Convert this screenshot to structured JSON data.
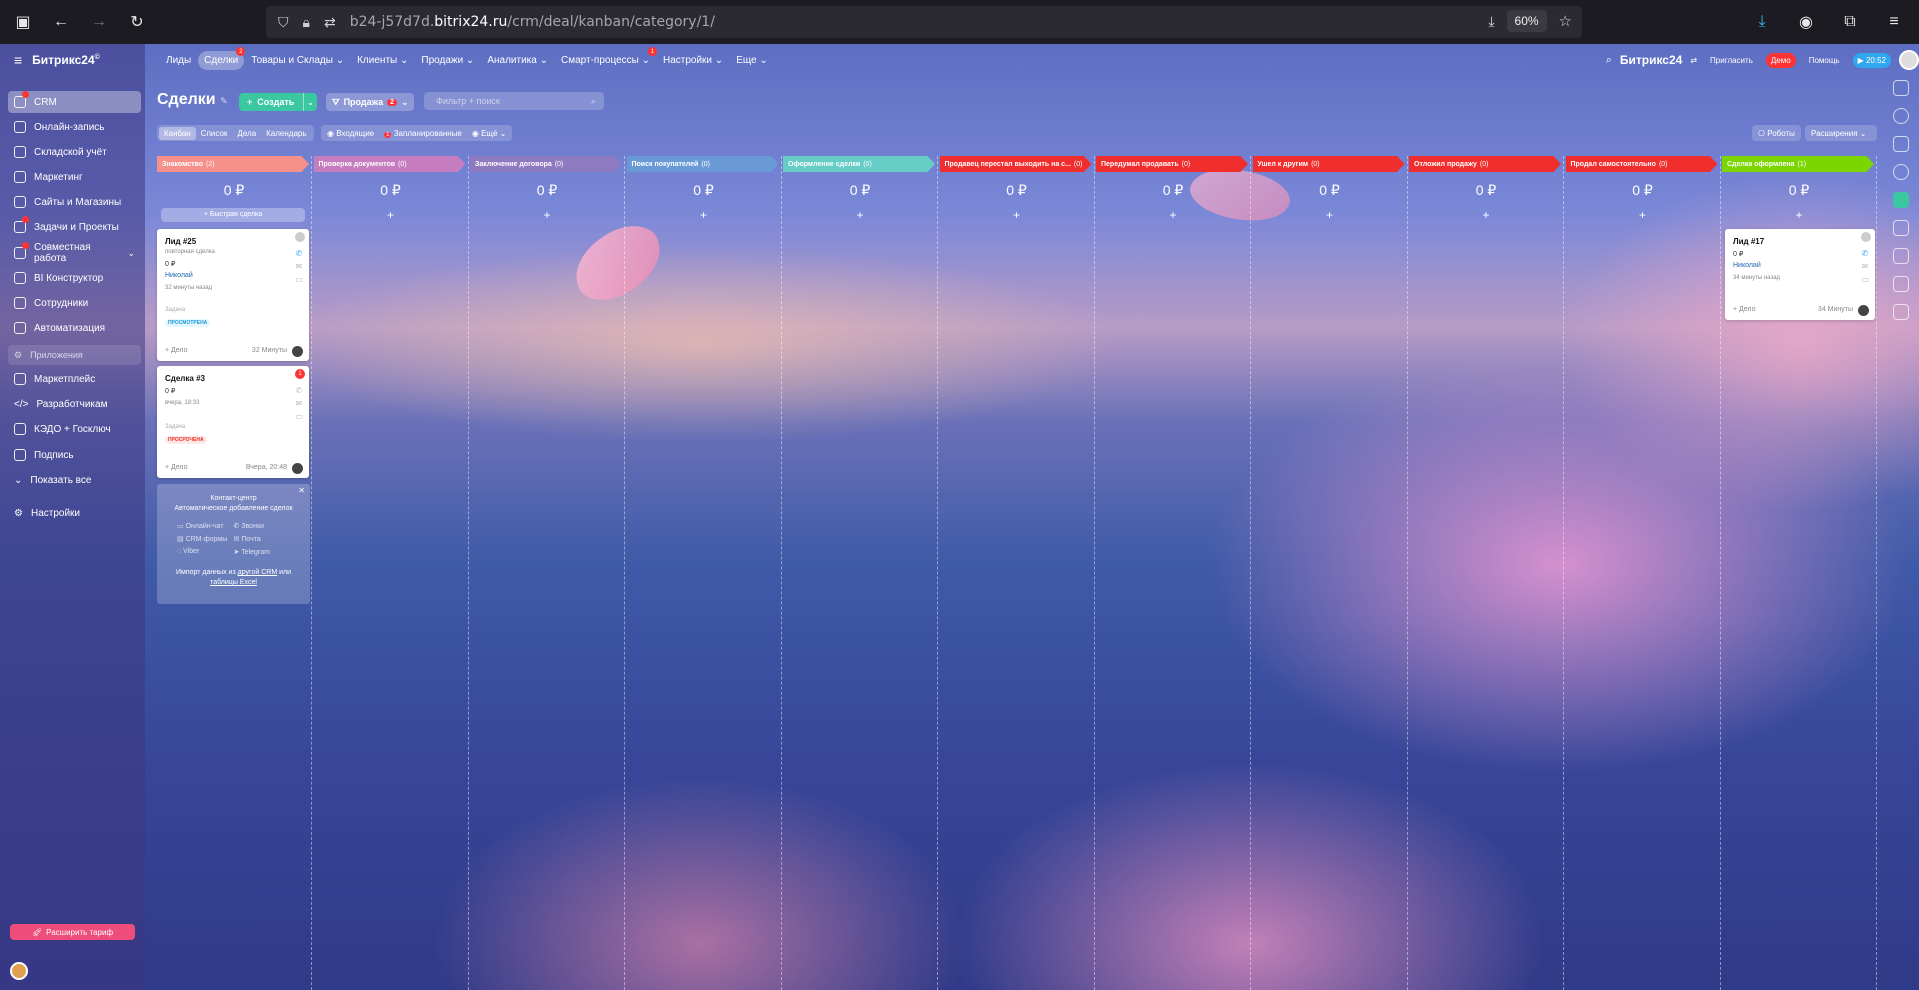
{
  "browser": {
    "url_prefix": "b24-j57d7d.",
    "url_domain": "bitrix24.ru",
    "url_path": "/crm/deal/kanban/category/1/",
    "zoom": "60%"
  },
  "sidebar": {
    "logo": "Битрикс24",
    "logo_sup": "©",
    "items": [
      {
        "label": "CRM",
        "badge": true
      },
      {
        "label": "Онлайн-запись"
      },
      {
        "label": "Складской учёт"
      },
      {
        "label": "Маркетинг"
      },
      {
        "label": "Сайты и Магазины"
      },
      {
        "label": "Задачи и Проекты",
        "badge": true
      },
      {
        "label": "Совместная работа",
        "badge": true
      },
      {
        "label": "BI Конструктор"
      },
      {
        "label": "Сотрудники"
      },
      {
        "label": "Автоматизация"
      }
    ],
    "section_label": "Приложения",
    "items2": [
      {
        "label": "Маркетплейс"
      },
      {
        "label": "Разработчикам"
      },
      {
        "label": "КЭДО + Госключ"
      },
      {
        "label": "Подпись"
      },
      {
        "label": "Показать все"
      },
      {
        "label": "Настройки"
      }
    ],
    "upgrade": "Расширить тариф"
  },
  "topnav": {
    "items": [
      "Лиды",
      "Сделки",
      "Товары и Склады",
      "Клиенты",
      "Продажи",
      "Аналитика",
      "Смарт-процессы",
      "Настройки",
      "Еще"
    ],
    "deals_badge": "2",
    "smart_badge": "1",
    "right_logo": "Битрикс24",
    "invite": "Пригласить",
    "demo": "Демо",
    "help": "Помощь",
    "time": "20:52"
  },
  "page": {
    "title": "Сделки",
    "create": "Создать",
    "category": "Продажа",
    "category_count": "2",
    "filter_placeholder": "Фильтр + поиск",
    "view_tabs": [
      "Канбан",
      "Список",
      "Дела",
      "Календарь"
    ],
    "presets": [
      "Входящие",
      "Запланированные",
      "Ещё"
    ],
    "presets_badge": "1",
    "robots": "Роботы",
    "extensions": "Расширения"
  },
  "columns": [
    {
      "name": "Знакомство",
      "count": "(2)",
      "color": "#f5918a",
      "sum": "0 ₽"
    },
    {
      "name": "Проверка документов",
      "count": "(0)",
      "color": "#c57dc0",
      "sum": "0 ₽"
    },
    {
      "name": "Заключение договора",
      "count": "(0)",
      "color": "#8d7ac0",
      "sum": "0 ₽"
    },
    {
      "name": "Поиск покупателей",
      "count": "(0)",
      "color": "#6a9ad6",
      "sum": "0 ₽"
    },
    {
      "name": "Оформление сделки",
      "count": "(0)",
      "color": "#66ccc6",
      "sum": "0 ₽"
    },
    {
      "name": "Продавец перестал выходить на с...",
      "count": "(0)",
      "color": "#f12e2e",
      "sum": "0 ₽"
    },
    {
      "name": "Передумал продавать",
      "count": "(0)",
      "color": "#f12e2e",
      "sum": "0 ₽"
    },
    {
      "name": "Ушел к другим",
      "count": "(0)",
      "color": "#f12e2e",
      "sum": "0 ₽"
    },
    {
      "name": "Отложил продажу",
      "count": "(0)",
      "color": "#f12e2e",
      "sum": "0 ₽"
    },
    {
      "name": "Продал самостоятельно",
      "count": "(0)",
      "color": "#f12e2e",
      "sum": "0 ₽"
    },
    {
      "name": "Сделка оформлена",
      "count": "(1)",
      "color": "#7bd500",
      "sum": "0 ₽"
    }
  ],
  "quick_deal": "Быстрая сделка",
  "cards": {
    "c1": {
      "title": "Лид #25",
      "sub": "повторная сделка",
      "sum": "0 ₽",
      "contact": "Николай",
      "ago": "32 минуты назад",
      "label": "Задача",
      "tag": "ПРОСМОТРЕНА",
      "act": "+ Дело",
      "time": "32 Минуты"
    },
    "c2": {
      "title": "Сделка #3",
      "sum": "0 ₽",
      "sub": "вчера, 18:33",
      "label": "Задача",
      "tag": "ПРОСРОЧЕНА",
      "act": "+ Дело",
      "time": "Вчера, 20:48",
      "corner": "1"
    },
    "c3": {
      "title": "Лид #17",
      "sum": "0 ₽",
      "contact": "Николай",
      "ago": "34 минуты назад",
      "act": "+ Дело",
      "time": "34 Минуты"
    }
  },
  "contact_center": {
    "title": "Контакт-центр",
    "subtitle": "Автоматическое добавление сделок",
    "channels": [
      "Онлайн-чат",
      "Звонки",
      "CRM-формы",
      "Почта",
      "Viber",
      "Telegram"
    ],
    "import_1": "Импорт данных из",
    "import_link1": "другой CRM",
    "import_2": "или",
    "import_link2": "таблицы Excel"
  }
}
